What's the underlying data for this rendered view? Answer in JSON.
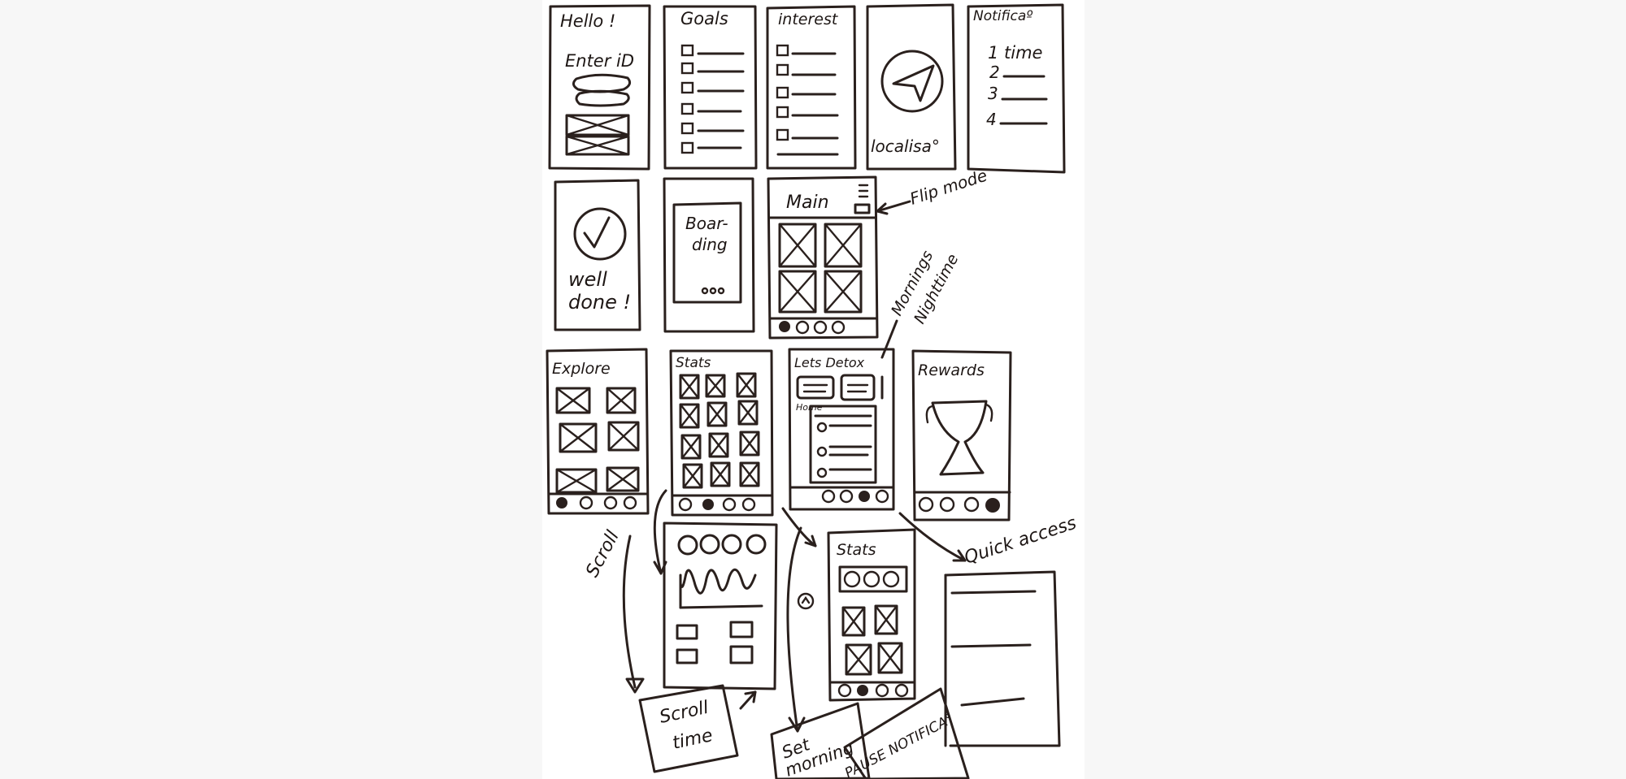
{
  "labels": {
    "hello": "Hello !",
    "enter_id": "Enter iD",
    "goals": "Goals",
    "interest": "interest",
    "localisa": "localisa°",
    "notifications": "Notificaº",
    "notif_items": [
      "1 time",
      "2",
      "3",
      "4"
    ],
    "well_done_1": "well",
    "well_done_2": "done !",
    "boarding_1": "Boar-",
    "boarding_2": "ding",
    "main": "Main",
    "flip_mode": "Flip mode",
    "mornings_1": "Mornings",
    "mornings_2": "Nighttime",
    "explore": "Explore",
    "stats": "Stats",
    "lets_detox": "Lets Detox",
    "home": "Home",
    "rewards": "Rewards",
    "scroll": "Scroll",
    "stats_2": "Stats",
    "quick_access": "Quick access",
    "scroll_time_1": "Scroll",
    "scroll_time_2": "time",
    "set_morning_1": "Set",
    "set_morning_2": "morning",
    "pause_notifica": "PAUSE NOTIFICA°"
  }
}
